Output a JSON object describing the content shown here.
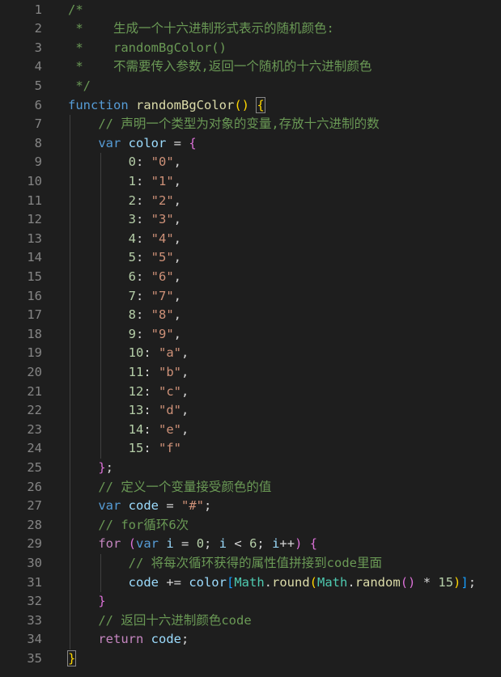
{
  "editor": {
    "language": "javascript",
    "theme_colors": {
      "background": "#1e1e1e",
      "line_number": "#858585",
      "comment": "#6a9955",
      "keyword": "#569cd6",
      "control_keyword": "#c586c0",
      "function": "#dcdcaa",
      "variable": "#9cdcfe",
      "string": "#ce9178",
      "number": "#b5cea8",
      "bracket_level1": "#ffd700",
      "bracket_level2": "#da70d6",
      "bracket_level3": "#179fff",
      "type": "#4ec9b0"
    },
    "lines": [
      {
        "n": "1",
        "tokens": [
          {
            "t": "/*",
            "c": "t-c"
          }
        ]
      },
      {
        "n": "2",
        "tokens": [
          {
            "t": " *    生成一个十六进制形式表示的随机颜色:",
            "c": "t-c"
          }
        ]
      },
      {
        "n": "3",
        "tokens": [
          {
            "t": " *    randomBgColor()",
            "c": "t-c"
          }
        ]
      },
      {
        "n": "4",
        "tokens": [
          {
            "t": " *    不需要传入参数,返回一个随机的十六进制颜色",
            "c": "t-c"
          }
        ]
      },
      {
        "n": "5",
        "tokens": [
          {
            "t": " */",
            "c": "t-c"
          }
        ]
      },
      {
        "n": "6",
        "tokens": [
          {
            "t": "function",
            "c": "t-k"
          },
          {
            "t": " ",
            "c": "t-o"
          },
          {
            "t": "randomBgColor",
            "c": "t-f"
          },
          {
            "t": "()",
            "c": "t-b1"
          },
          {
            "t": " ",
            "c": "t-o"
          },
          {
            "t": "{",
            "c": "t-b1 match"
          }
        ]
      },
      {
        "n": "7",
        "tokens": [
          {
            "t": "    // 声明一个类型为对象的变量,存放十六进制的数",
            "c": "t-c"
          }
        ]
      },
      {
        "n": "8",
        "tokens": [
          {
            "t": "    ",
            "c": "t-o"
          },
          {
            "t": "var",
            "c": "t-k"
          },
          {
            "t": " ",
            "c": "t-o"
          },
          {
            "t": "color",
            "c": "t-v"
          },
          {
            "t": " = ",
            "c": "t-o"
          },
          {
            "t": "{",
            "c": "t-b2"
          }
        ]
      },
      {
        "n": "9",
        "tokens": [
          {
            "t": "        ",
            "c": "t-o"
          },
          {
            "t": "0",
            "c": "t-n"
          },
          {
            "t": ": ",
            "c": "t-o"
          },
          {
            "t": "\"0\"",
            "c": "t-s"
          },
          {
            "t": ",",
            "c": "t-o"
          }
        ]
      },
      {
        "n": "10",
        "tokens": [
          {
            "t": "        ",
            "c": "t-o"
          },
          {
            "t": "1",
            "c": "t-n"
          },
          {
            "t": ": ",
            "c": "t-o"
          },
          {
            "t": "\"1\"",
            "c": "t-s"
          },
          {
            "t": ",",
            "c": "t-o"
          }
        ]
      },
      {
        "n": "11",
        "tokens": [
          {
            "t": "        ",
            "c": "t-o"
          },
          {
            "t": "2",
            "c": "t-n"
          },
          {
            "t": ": ",
            "c": "t-o"
          },
          {
            "t": "\"2\"",
            "c": "t-s"
          },
          {
            "t": ",",
            "c": "t-o"
          }
        ]
      },
      {
        "n": "12",
        "tokens": [
          {
            "t": "        ",
            "c": "t-o"
          },
          {
            "t": "3",
            "c": "t-n"
          },
          {
            "t": ": ",
            "c": "t-o"
          },
          {
            "t": "\"3\"",
            "c": "t-s"
          },
          {
            "t": ",",
            "c": "t-o"
          }
        ]
      },
      {
        "n": "13",
        "tokens": [
          {
            "t": "        ",
            "c": "t-o"
          },
          {
            "t": "4",
            "c": "t-n"
          },
          {
            "t": ": ",
            "c": "t-o"
          },
          {
            "t": "\"4\"",
            "c": "t-s"
          },
          {
            "t": ",",
            "c": "t-o"
          }
        ]
      },
      {
        "n": "14",
        "tokens": [
          {
            "t": "        ",
            "c": "t-o"
          },
          {
            "t": "5",
            "c": "t-n"
          },
          {
            "t": ": ",
            "c": "t-o"
          },
          {
            "t": "\"5\"",
            "c": "t-s"
          },
          {
            "t": ",",
            "c": "t-o"
          }
        ]
      },
      {
        "n": "15",
        "tokens": [
          {
            "t": "        ",
            "c": "t-o"
          },
          {
            "t": "6",
            "c": "t-n"
          },
          {
            "t": ": ",
            "c": "t-o"
          },
          {
            "t": "\"6\"",
            "c": "t-s"
          },
          {
            "t": ",",
            "c": "t-o"
          }
        ]
      },
      {
        "n": "16",
        "tokens": [
          {
            "t": "        ",
            "c": "t-o"
          },
          {
            "t": "7",
            "c": "t-n"
          },
          {
            "t": ": ",
            "c": "t-o"
          },
          {
            "t": "\"7\"",
            "c": "t-s"
          },
          {
            "t": ",",
            "c": "t-o"
          }
        ]
      },
      {
        "n": "17",
        "tokens": [
          {
            "t": "        ",
            "c": "t-o"
          },
          {
            "t": "8",
            "c": "t-n"
          },
          {
            "t": ": ",
            "c": "t-o"
          },
          {
            "t": "\"8\"",
            "c": "t-s"
          },
          {
            "t": ",",
            "c": "t-o"
          }
        ]
      },
      {
        "n": "18",
        "tokens": [
          {
            "t": "        ",
            "c": "t-o"
          },
          {
            "t": "9",
            "c": "t-n"
          },
          {
            "t": ": ",
            "c": "t-o"
          },
          {
            "t": "\"9\"",
            "c": "t-s"
          },
          {
            "t": ",",
            "c": "t-o"
          }
        ]
      },
      {
        "n": "19",
        "tokens": [
          {
            "t": "        ",
            "c": "t-o"
          },
          {
            "t": "10",
            "c": "t-n"
          },
          {
            "t": ": ",
            "c": "t-o"
          },
          {
            "t": "\"a\"",
            "c": "t-s"
          },
          {
            "t": ",",
            "c": "t-o"
          }
        ]
      },
      {
        "n": "20",
        "tokens": [
          {
            "t": "        ",
            "c": "t-o"
          },
          {
            "t": "11",
            "c": "t-n"
          },
          {
            "t": ": ",
            "c": "t-o"
          },
          {
            "t": "\"b\"",
            "c": "t-s"
          },
          {
            "t": ",",
            "c": "t-o"
          }
        ]
      },
      {
        "n": "21",
        "tokens": [
          {
            "t": "        ",
            "c": "t-o"
          },
          {
            "t": "12",
            "c": "t-n"
          },
          {
            "t": ": ",
            "c": "t-o"
          },
          {
            "t": "\"c\"",
            "c": "t-s"
          },
          {
            "t": ",",
            "c": "t-o"
          }
        ]
      },
      {
        "n": "22",
        "tokens": [
          {
            "t": "        ",
            "c": "t-o"
          },
          {
            "t": "13",
            "c": "t-n"
          },
          {
            "t": ": ",
            "c": "t-o"
          },
          {
            "t": "\"d\"",
            "c": "t-s"
          },
          {
            "t": ",",
            "c": "t-o"
          }
        ]
      },
      {
        "n": "23",
        "tokens": [
          {
            "t": "        ",
            "c": "t-o"
          },
          {
            "t": "14",
            "c": "t-n"
          },
          {
            "t": ": ",
            "c": "t-o"
          },
          {
            "t": "\"e\"",
            "c": "t-s"
          },
          {
            "t": ",",
            "c": "t-o"
          }
        ]
      },
      {
        "n": "24",
        "tokens": [
          {
            "t": "        ",
            "c": "t-o"
          },
          {
            "t": "15",
            "c": "t-n"
          },
          {
            "t": ": ",
            "c": "t-o"
          },
          {
            "t": "\"f\"",
            "c": "t-s"
          }
        ]
      },
      {
        "n": "25",
        "tokens": [
          {
            "t": "    ",
            "c": "t-o"
          },
          {
            "t": "}",
            "c": "t-b2"
          },
          {
            "t": ";",
            "c": "t-o"
          }
        ]
      },
      {
        "n": "26",
        "tokens": [
          {
            "t": "    // 定义一个变量接受颜色的值",
            "c": "t-c"
          }
        ]
      },
      {
        "n": "27",
        "tokens": [
          {
            "t": "    ",
            "c": "t-o"
          },
          {
            "t": "var",
            "c": "t-k"
          },
          {
            "t": " ",
            "c": "t-o"
          },
          {
            "t": "code",
            "c": "t-v"
          },
          {
            "t": " = ",
            "c": "t-o"
          },
          {
            "t": "\"#\"",
            "c": "t-s"
          },
          {
            "t": ";",
            "c": "t-o"
          }
        ]
      },
      {
        "n": "28",
        "tokens": [
          {
            "t": "    // for循环6次",
            "c": "t-c"
          }
        ]
      },
      {
        "n": "29",
        "tokens": [
          {
            "t": "    ",
            "c": "t-o"
          },
          {
            "t": "for",
            "c": "t-kc"
          },
          {
            "t": " ",
            "c": "t-o"
          },
          {
            "t": "(",
            "c": "t-b2"
          },
          {
            "t": "var",
            "c": "t-k"
          },
          {
            "t": " ",
            "c": "t-o"
          },
          {
            "t": "i",
            "c": "t-v"
          },
          {
            "t": " = ",
            "c": "t-o"
          },
          {
            "t": "0",
            "c": "t-n"
          },
          {
            "t": "; ",
            "c": "t-o"
          },
          {
            "t": "i",
            "c": "t-v"
          },
          {
            "t": " < ",
            "c": "t-o"
          },
          {
            "t": "6",
            "c": "t-n"
          },
          {
            "t": "; ",
            "c": "t-o"
          },
          {
            "t": "i",
            "c": "t-v"
          },
          {
            "t": "++",
            "c": "t-o"
          },
          {
            "t": ")",
            "c": "t-b2"
          },
          {
            "t": " ",
            "c": "t-o"
          },
          {
            "t": "{",
            "c": "t-b2"
          }
        ]
      },
      {
        "n": "30",
        "tokens": [
          {
            "t": "        // 将每次循环获得的属性值拼接到code里面",
            "c": "t-c"
          }
        ]
      },
      {
        "n": "31",
        "tokens": [
          {
            "t": "        ",
            "c": "t-o"
          },
          {
            "t": "code",
            "c": "t-v"
          },
          {
            "t": " += ",
            "c": "t-o"
          },
          {
            "t": "color",
            "c": "t-v"
          },
          {
            "t": "[",
            "c": "t-b3"
          },
          {
            "t": "Math",
            "c": "t-ty"
          },
          {
            "t": ".",
            "c": "t-o"
          },
          {
            "t": "round",
            "c": "t-f"
          },
          {
            "t": "(",
            "c": "t-b1"
          },
          {
            "t": "Math",
            "c": "t-ty"
          },
          {
            "t": ".",
            "c": "t-o"
          },
          {
            "t": "random",
            "c": "t-f"
          },
          {
            "t": "()",
            "c": "t-b2"
          },
          {
            "t": " * ",
            "c": "t-o"
          },
          {
            "t": "15",
            "c": "t-n"
          },
          {
            "t": ")",
            "c": "t-b1"
          },
          {
            "t": "]",
            "c": "t-b3"
          },
          {
            "t": ";",
            "c": "t-o"
          }
        ]
      },
      {
        "n": "32",
        "tokens": [
          {
            "t": "    ",
            "c": "t-o"
          },
          {
            "t": "}",
            "c": "t-b2"
          }
        ]
      },
      {
        "n": "33",
        "tokens": [
          {
            "t": "    // 返回十六进制颜色code",
            "c": "t-c"
          }
        ]
      },
      {
        "n": "34",
        "tokens": [
          {
            "t": "    ",
            "c": "t-o"
          },
          {
            "t": "return",
            "c": "t-kc"
          },
          {
            "t": " ",
            "c": "t-o"
          },
          {
            "t": "code",
            "c": "t-v"
          },
          {
            "t": ";",
            "c": "t-o"
          }
        ]
      },
      {
        "n": "35",
        "tokens": [
          {
            "t": "}",
            "c": "t-b1 match"
          }
        ]
      }
    ]
  }
}
